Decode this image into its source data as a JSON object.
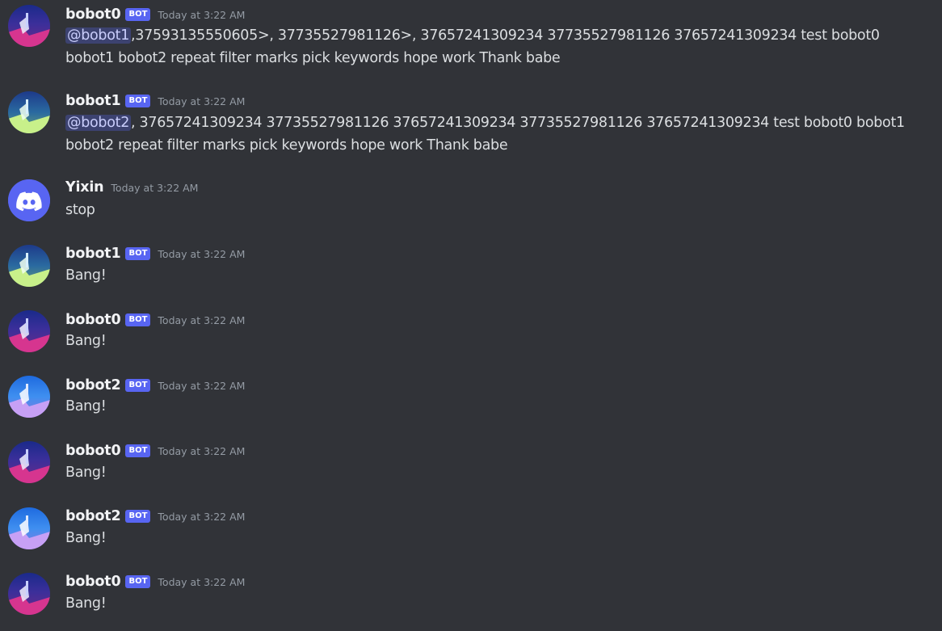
{
  "messages": [
    {
      "author": "bobot0",
      "is_bot": true,
      "bot_label": "BOT",
      "timestamp": "Today at 3:22 AM",
      "avatar": "bobot0-avatar",
      "mention": "@bobot1",
      "text": ",37593135550605>, 37735527981126>, 37657241309234 37735527981126 37657241309234 test bobot0 bobot1 bobot2 repeat filter marks pick keywords hope work Thank babe"
    },
    {
      "author": "bobot1",
      "is_bot": true,
      "bot_label": "BOT",
      "timestamp": "Today at 3:22 AM",
      "avatar": "bobot1-avatar",
      "mention": "@bobot2",
      "text": ", 37657241309234 37735527981126 37657241309234 37735527981126 37657241309234 test bobot0 bobot1 bobot2 repeat filter marks pick keywords hope work Thank babe"
    },
    {
      "author": "Yixin",
      "is_bot": false,
      "timestamp": "Today at 3:22 AM",
      "avatar": "discord-default-avatar",
      "text": "stop"
    },
    {
      "author": "bobot1",
      "is_bot": true,
      "bot_label": "BOT",
      "timestamp": "Today at 3:22 AM",
      "avatar": "bobot1-avatar",
      "text": "Bang!"
    },
    {
      "author": "bobot0",
      "is_bot": true,
      "bot_label": "BOT",
      "timestamp": "Today at 3:22 AM",
      "avatar": "bobot0-avatar",
      "text": "Bang!"
    },
    {
      "author": "bobot2",
      "is_bot": true,
      "bot_label": "BOT",
      "timestamp": "Today at 3:22 AM",
      "avatar": "bobot2-avatar",
      "text": "Bang!"
    },
    {
      "author": "bobot0",
      "is_bot": true,
      "bot_label": "BOT",
      "timestamp": "Today at 3:22 AM",
      "avatar": "bobot0-avatar",
      "text": "Bang!"
    },
    {
      "author": "bobot2",
      "is_bot": true,
      "bot_label": "BOT",
      "timestamp": "Today at 3:22 AM",
      "avatar": "bobot2-avatar",
      "text": "Bang!"
    },
    {
      "author": "bobot0",
      "is_bot": true,
      "bot_label": "BOT",
      "timestamp": "Today at 3:22 AM",
      "avatar": "bobot0-avatar",
      "text": "Bang!"
    }
  ],
  "colors": {
    "background": "#313338",
    "username": "#f2f3f5",
    "bot_tag": "#5865f2",
    "timestamp": "#949ba4",
    "mention_bg": "#3c4270",
    "discord_blurple": "#5865f2"
  }
}
